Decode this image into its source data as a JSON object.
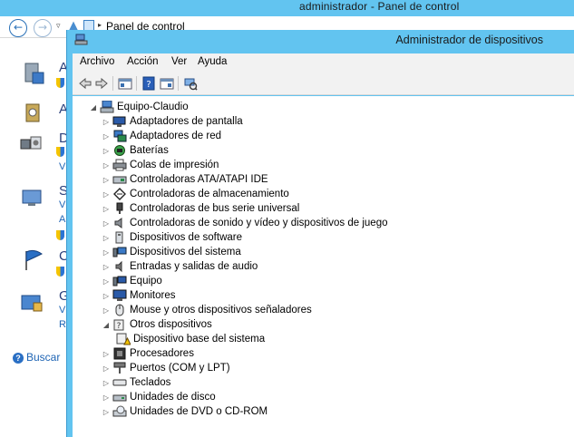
{
  "background_window": {
    "title": "administrador - Panel de control",
    "breadcrumb": "Panel de control",
    "help_link": "Buscar",
    "left_letters": [
      "A",
      "A",
      "D",
      "S",
      "C",
      "G"
    ],
    "left_small": [
      "V",
      "V",
      "A",
      "V",
      "R"
    ]
  },
  "device_manager": {
    "title": "Administrador de dispositivos",
    "menu": [
      "Archivo",
      "Acción",
      "Ver",
      "Ayuda"
    ],
    "tree": {
      "root": "Equipo-Claudio",
      "items": [
        {
          "label": "Adaptadores de pantalla",
          "icon": "display-adapter-icon",
          "expanded": false
        },
        {
          "label": "Adaptadores de red",
          "icon": "network-adapter-icon",
          "expanded": false
        },
        {
          "label": "Baterías",
          "icon": "battery-icon",
          "expanded": false
        },
        {
          "label": "Colas de impresión",
          "icon": "printer-icon",
          "expanded": false
        },
        {
          "label": "Controladoras ATA/ATAPI IDE",
          "icon": "ide-controller-icon",
          "expanded": false
        },
        {
          "label": "Controladoras de almacenamiento",
          "icon": "storage-controller-icon",
          "expanded": false
        },
        {
          "label": "Controladoras de bus serie universal",
          "icon": "usb-controller-icon",
          "expanded": false
        },
        {
          "label": "Controladoras de sonido y vídeo y dispositivos de juego",
          "icon": "sound-icon",
          "expanded": false
        },
        {
          "label": "Dispositivos de software",
          "icon": "software-device-icon",
          "expanded": false
        },
        {
          "label": "Dispositivos del sistema",
          "icon": "system-device-icon",
          "expanded": false
        },
        {
          "label": "Entradas y salidas de audio",
          "icon": "audio-io-icon",
          "expanded": false
        },
        {
          "label": "Equipo",
          "icon": "computer-icon",
          "expanded": false
        },
        {
          "label": "Monitores",
          "icon": "monitor-icon",
          "expanded": false
        },
        {
          "label": "Mouse y otros dispositivos señaladores",
          "icon": "mouse-icon",
          "expanded": false
        },
        {
          "label": "Otros dispositivos",
          "icon": "other-devices-icon",
          "expanded": true,
          "children": [
            {
              "label": "Dispositivo base del sistema",
              "icon": "unknown-device-warning-icon"
            }
          ]
        },
        {
          "label": "Procesadores",
          "icon": "processor-icon",
          "expanded": false
        },
        {
          "label": "Puertos (COM y LPT)",
          "icon": "port-icon",
          "expanded": false
        },
        {
          "label": "Teclados",
          "icon": "keyboard-icon",
          "expanded": false
        },
        {
          "label": "Unidades de disco",
          "icon": "disk-drive-icon",
          "expanded": false
        },
        {
          "label": "Unidades de DVD o CD-ROM",
          "icon": "dvd-drive-icon",
          "expanded": false
        }
      ]
    }
  }
}
